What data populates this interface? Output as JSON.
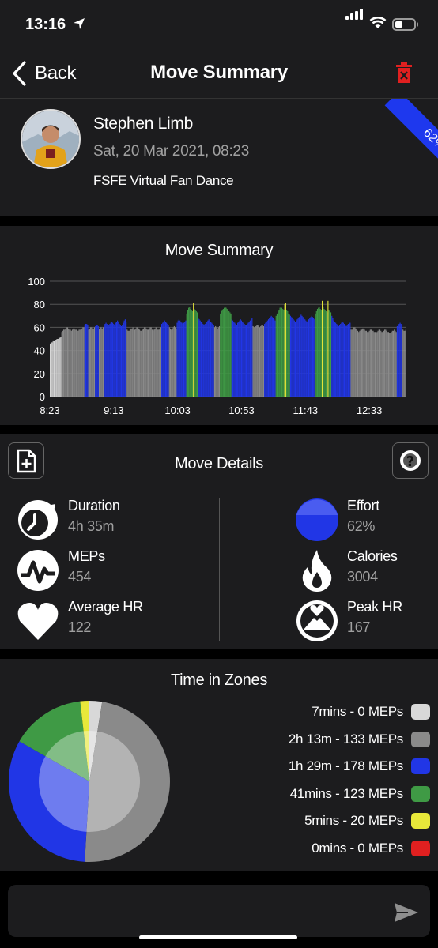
{
  "status_bar": {
    "time": "13:16",
    "battery_level": 0.4
  },
  "nav": {
    "back_label": "Back",
    "title": "Move Summary",
    "delete_icon": "trash-icon",
    "delete_color": "#e02020"
  },
  "profile": {
    "name": "Stephen Limb",
    "date": "Sat, 20 Mar 2021, 08:23",
    "event": "FSFE Virtual Fan Dance",
    "effort_badge": "62%",
    "badge_color": "#1e38ee"
  },
  "summary_chart": {
    "title": "Move Summary",
    "chart_data": {
      "type": "bar",
      "title": "Move Summary",
      "ylim": [
        0,
        100
      ],
      "yticks": [
        0,
        20,
        40,
        60,
        80,
        100
      ],
      "x_tick_labels": [
        "8:23",
        "9:13",
        "10:03",
        "10:53",
        "11:43",
        "12:33"
      ],
      "grid": true,
      "zone_colors": {
        "white": "#d8d8d8",
        "grey": "#8a8a8a",
        "blue": "#2136e6",
        "green": "#3f9a45",
        "yellow": "#e8e83a"
      },
      "segments": [
        {
          "zone": "white",
          "values": [
            46,
            47,
            47,
            48,
            48,
            49,
            49,
            50,
            50,
            51,
            51,
            52
          ]
        },
        {
          "zone": "grey",
          "values": [
            56,
            57,
            58,
            58,
            59,
            60,
            60,
            59,
            58,
            58,
            57,
            58,
            59,
            59,
            58,
            58,
            57,
            57,
            58,
            58,
            59,
            59,
            60,
            60
          ]
        },
        {
          "zone": "blue",
          "values": [
            62,
            63,
            63,
            62
          ]
        },
        {
          "zone": "grey",
          "values": [
            58,
            59,
            60,
            60,
            59,
            59,
            60
          ]
        },
        {
          "zone": "blue",
          "values": [
            61,
            62,
            62,
            61
          ]
        },
        {
          "zone": "grey",
          "values": [
            59,
            60,
            60,
            59,
            60
          ]
        },
        {
          "zone": "blue",
          "values": [
            62,
            63,
            64,
            63,
            62,
            62,
            63,
            64,
            65,
            64,
            63,
            62,
            64,
            65,
            66,
            65,
            63,
            62,
            61,
            62,
            64,
            66,
            67,
            65
          ]
        },
        {
          "zone": "grey",
          "values": [
            58,
            57,
            57,
            58,
            59,
            59,
            60,
            58,
            58,
            59,
            60,
            60,
            59,
            58,
            57,
            57,
            58,
            59,
            60,
            60,
            59,
            58,
            58,
            59,
            60,
            60,
            58,
            57,
            58,
            59,
            60,
            59,
            58,
            58,
            59,
            60
          ]
        },
        {
          "zone": "blue",
          "values": [
            63,
            64,
            65,
            66,
            65,
            64,
            63,
            62
          ]
        },
        {
          "zone": "grey",
          "values": [
            60,
            59,
            58,
            59,
            60,
            61,
            60,
            59
          ]
        },
        {
          "zone": "blue",
          "values": [
            64,
            66,
            67,
            66,
            65,
            64,
            63,
            64,
            65,
            66
          ]
        },
        {
          "zone": "green",
          "values": [
            72,
            75,
            77,
            78,
            76,
            75,
            74
          ]
        },
        {
          "zone": "yellow",
          "values": [
            81
          ]
        },
        {
          "zone": "green",
          "values": [
            76,
            75,
            74,
            73
          ]
        },
        {
          "zone": "blue",
          "values": [
            68,
            67,
            66,
            65,
            64,
            63,
            62,
            63,
            64,
            65,
            66,
            67,
            66,
            65,
            64,
            63,
            62
          ]
        },
        {
          "zone": "grey",
          "values": [
            60,
            61,
            60,
            59,
            60,
            61
          ]
        },
        {
          "zone": "green",
          "values": [
            72,
            74,
            75,
            76,
            77,
            78,
            77,
            76,
            75,
            74,
            73,
            72
          ]
        },
        {
          "zone": "blue",
          "values": [
            67,
            66,
            65,
            64,
            63,
            62,
            64,
            65,
            66,
            67,
            66,
            65,
            64,
            63,
            62,
            62,
            63,
            64,
            65,
            66,
            67,
            68
          ]
        },
        {
          "zone": "grey",
          "values": [
            61,
            60,
            60,
            61,
            62,
            62,
            61,
            60,
            61,
            62,
            62,
            61
          ]
        },
        {
          "zone": "blue",
          "values": [
            63,
            64,
            65,
            66,
            67,
            68,
            69,
            70,
            69,
            68,
            67,
            66
          ]
        },
        {
          "zone": "green",
          "values": [
            70,
            72,
            74,
            75,
            77,
            78,
            77,
            76,
            75
          ]
        },
        {
          "zone": "yellow",
          "values": [
            80,
            81
          ]
        },
        {
          "zone": "green",
          "values": [
            75,
            74,
            72,
            71
          ]
        },
        {
          "zone": "blue",
          "values": [
            70,
            69,
            68,
            67,
            66,
            65,
            66,
            67,
            68,
            69,
            70,
            71,
            70,
            69,
            68,
            67,
            66,
            65,
            66,
            67,
            68,
            69,
            70,
            69,
            68,
            67
          ]
        },
        {
          "zone": "green",
          "values": [
            72,
            74,
            76,
            77,
            78,
            76,
            75
          ]
        },
        {
          "zone": "yellow",
          "values": [
            83
          ]
        },
        {
          "zone": "green",
          "values": [
            78,
            76,
            75,
            74,
            73
          ]
        },
        {
          "zone": "yellow",
          "values": [
            83
          ]
        },
        {
          "zone": "green",
          "values": [
            75,
            74,
            73
          ]
        },
        {
          "zone": "blue",
          "values": [
            70,
            68,
            66,
            65,
            64,
            63,
            62,
            61,
            62,
            63,
            64,
            65,
            64,
            63,
            62,
            61,
            62,
            63,
            64,
            64
          ]
        },
        {
          "zone": "grey",
          "values": [
            58,
            58,
            59,
            60,
            60,
            59,
            58,
            57,
            56,
            57,
            58,
            58,
            59,
            59,
            58,
            57,
            57,
            56,
            56,
            57,
            58,
            58,
            57,
            57,
            56,
            56,
            55,
            56,
            57,
            58,
            58,
            57,
            56,
            56,
            57,
            58,
            58,
            57,
            56,
            56,
            55,
            55,
            56,
            57,
            57,
            58,
            57,
            56
          ]
        },
        {
          "zone": "blue",
          "values": [
            61,
            62,
            63,
            64,
            63,
            62
          ]
        },
        {
          "zone": "grey",
          "values": [
            58,
            57,
            57,
            58
          ]
        }
      ]
    }
  },
  "details": {
    "title": "Move Details",
    "left": [
      {
        "icon": "stopwatch-icon",
        "label": "Duration",
        "value": "4h 35m"
      },
      {
        "icon": "meps-pulse-icon",
        "label": "MEPs",
        "value": "454"
      },
      {
        "icon": "heart-icon",
        "label": "Average HR",
        "value": "122"
      }
    ],
    "right": [
      {
        "icon": "effort-circle-icon",
        "label": "Effort",
        "value": "62%"
      },
      {
        "icon": "flame-icon",
        "label": "Calories",
        "value": "3004"
      },
      {
        "icon": "peak-heart-icon",
        "label": "Peak HR",
        "value": "167"
      }
    ],
    "effort_color": "#2136e6"
  },
  "zones": {
    "title": "Time in Zones",
    "chart_data": {
      "type": "pie",
      "title": "Time in Zones",
      "legend_position": "right",
      "outer_ring_minutes": [
        {
          "label": "7mins - 0 MEPs",
          "minutes": 7,
          "color": "#d8d8d8"
        },
        {
          "label": "2h 13m - 133 MEPs",
          "minutes": 133,
          "color": "#8a8a8a"
        },
        {
          "label": "1h 29m - 178 MEPs",
          "minutes": 89,
          "color": "#2136e6"
        },
        {
          "label": "41mins - 123 MEPs",
          "minutes": 41,
          "color": "#3f9a45"
        },
        {
          "label": "5mins - 20 MEPs",
          "minutes": 5,
          "color": "#e8e83a"
        },
        {
          "label": "0mins - 0 MEPs",
          "minutes": 0,
          "color": "#e02020"
        }
      ]
    }
  }
}
